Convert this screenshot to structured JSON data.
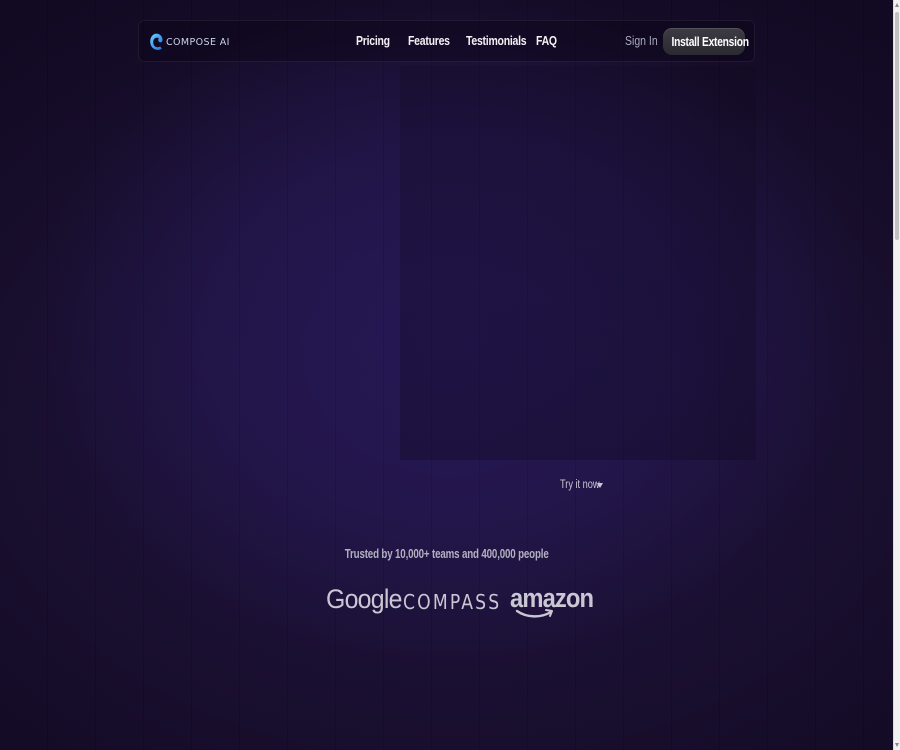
{
  "brand": {
    "name": "COMPOSE AI",
    "icon": "compose-logo-icon",
    "color": "#3aa0ff"
  },
  "nav": {
    "links": [
      "Pricing",
      "Features",
      "Testimonials",
      "FAQ"
    ],
    "sign_in": "Sign In",
    "install": "Install Extension"
  },
  "hero": {
    "try_now": "Try it now",
    "try_now_icon": "caret-down-icon"
  },
  "trusted": {
    "text": "Trusted by 10,000+ teams and 400,000 people",
    "logos": [
      "Google",
      "COMPASS",
      "amazon"
    ]
  },
  "colors": {
    "background": "#1a0f33",
    "button": "#35333a",
    "text": "#f2f2f4"
  }
}
